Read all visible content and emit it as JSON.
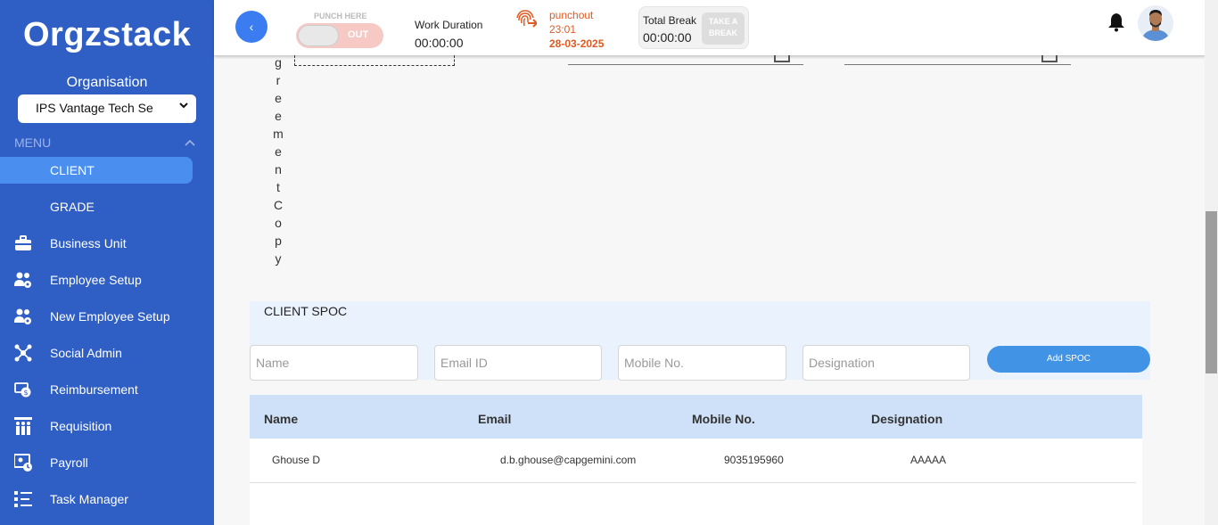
{
  "sidebar": {
    "logo": "Orgzstack",
    "org_label": "Organisation",
    "org_selected": "IPS Vantage Tech Se",
    "menu_label": "MENU",
    "items": [
      {
        "label": "CLIENT",
        "icon": "none",
        "active": true
      },
      {
        "label": "GRADE",
        "icon": "none",
        "active": false
      },
      {
        "label": "Business Unit",
        "icon": "briefcase-icon",
        "active": false
      },
      {
        "label": "Employee Setup",
        "icon": "users-gear-icon",
        "active": false
      },
      {
        "label": "New Employee Setup",
        "icon": "users-gear-icon",
        "active": false
      },
      {
        "label": "Social Admin",
        "icon": "network-icon",
        "active": false
      },
      {
        "label": "Reimbursement",
        "icon": "money-icon",
        "active": false
      },
      {
        "label": "Requisition",
        "icon": "people-chart-icon",
        "active": false
      },
      {
        "label": "Payroll",
        "icon": "payroll-icon",
        "active": false
      },
      {
        "label": "Task Manager",
        "icon": "task-list-icon",
        "active": false
      }
    ]
  },
  "topbar": {
    "back_label": "‹",
    "punch_here": "PUNCH HERE",
    "punch_toggle": "OUT",
    "work_duration_label": "Work Duration",
    "work_duration_value": "00:00:00",
    "punch_status": "punchout",
    "punch_time": "23:01",
    "punch_date": "28-03-2025",
    "total_break_label": "Total Break",
    "total_break_value": "00:00:00",
    "take_break_label": "TAKE A BREAK"
  },
  "content": {
    "vertical_text": [
      "g",
      "r",
      "e",
      "e",
      "m",
      "e",
      "n",
      "t",
      "C",
      "o",
      "p",
      "y"
    ],
    "spoc_title": "CLIENT SPOC",
    "inputs": {
      "name_placeholder": "Name",
      "email_placeholder": "Email ID",
      "mobile_placeholder": "Mobile No.",
      "designation_placeholder": "Designation"
    },
    "add_spoc_label": "Add SPOC",
    "table": {
      "headers": [
        "Name",
        "Email",
        "Mobile No.",
        "Designation"
      ],
      "rows": [
        [
          "Ghouse D",
          "d.b.ghouse@capgemini.com",
          "9035195960",
          "AAAAA"
        ]
      ]
    }
  },
  "colors": {
    "sidebar_bg": "#2f5fc4",
    "active_item": "#4a8ff0",
    "punch_orange": "#e05a22",
    "add_button": "#4193e6"
  }
}
